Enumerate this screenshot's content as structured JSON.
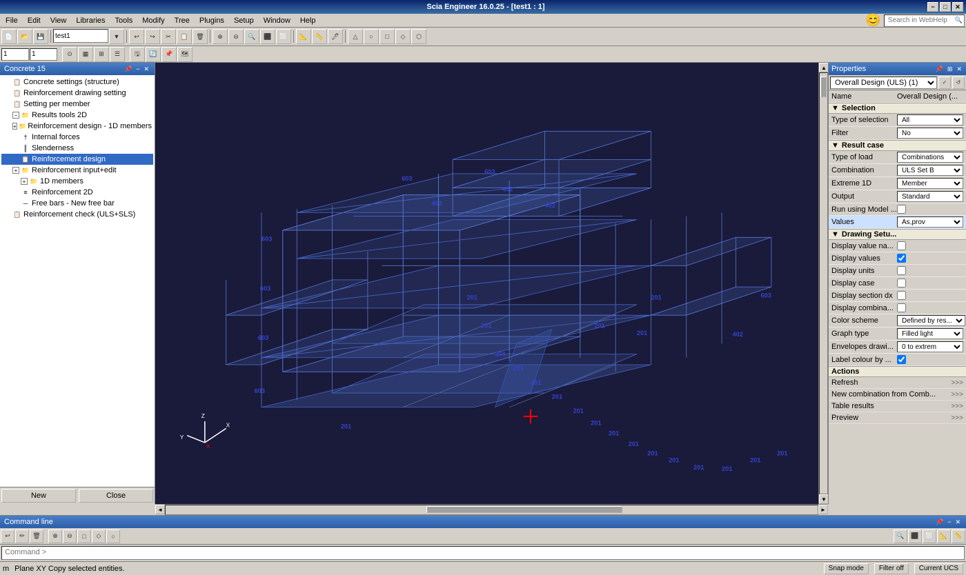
{
  "titlebar": {
    "title": "Scia Engineer 16.0.25 - [test1 : 1]",
    "minimize": "−",
    "maximize": "□",
    "close": "✕"
  },
  "menubar": {
    "items": [
      "File",
      "Edit",
      "View",
      "Libraries",
      "Tools",
      "Modify",
      "Tree",
      "Plugins",
      "Setup",
      "Window",
      "Help"
    ]
  },
  "webhelp": {
    "placeholder": "Search in WebHelp"
  },
  "leftpanel": {
    "title": "Concrete 15",
    "items": [
      {
        "label": "Concrete settings (structure)",
        "indent": 1,
        "icon": "📋",
        "expand": null
      },
      {
        "label": "Reinforcement drawing setting",
        "indent": 1,
        "icon": "📋",
        "expand": null
      },
      {
        "label": "Setting per member",
        "indent": 1,
        "icon": "📋",
        "expand": null
      },
      {
        "label": "Results tools 2D",
        "indent": 1,
        "icon": "📁",
        "expand": "-"
      },
      {
        "label": "Reinforcement design - 1D members",
        "indent": 1,
        "icon": "📁",
        "expand": "+"
      },
      {
        "label": "Internal forces",
        "indent": 2,
        "icon": "📋",
        "expand": null
      },
      {
        "label": "Slenderness",
        "indent": 2,
        "icon": "📋",
        "expand": null
      },
      {
        "label": "Reinforcement design",
        "indent": 2,
        "icon": "📋",
        "expand": null,
        "selected": true
      },
      {
        "label": "Reinforcement input+edit",
        "indent": 1,
        "icon": "📁",
        "expand": "+"
      },
      {
        "label": "1D members",
        "indent": 2,
        "icon": "📁",
        "expand": "+"
      },
      {
        "label": "Reinforcement 2D",
        "indent": 2,
        "icon": "📋",
        "expand": null
      },
      {
        "label": "Free bars - New free bar",
        "indent": 2,
        "icon": "📋",
        "expand": null
      },
      {
        "label": "Reinforcement check (ULS+SLS)",
        "indent": 1,
        "icon": "📋",
        "expand": null
      }
    ],
    "bottom_buttons": [
      "New",
      "Close"
    ]
  },
  "rightpanel": {
    "title": "Properties",
    "dropdown_label": "Overall Design (ULS) (1)",
    "name_label": "Name",
    "name_value": "Overall Design (...",
    "sections": {
      "selection": {
        "header": "Selection",
        "rows": [
          {
            "label": "Type of selection",
            "value": "All",
            "type": "dropdown"
          },
          {
            "label": "Filter",
            "value": "No",
            "type": "dropdown"
          }
        ]
      },
      "result_case": {
        "header": "Result case",
        "rows": [
          {
            "label": "Type of load",
            "value": "Combinations",
            "type": "dropdown"
          },
          {
            "label": "Combination",
            "value": "ULS Set B",
            "type": "dropdown"
          },
          {
            "label": "Extreme 1D",
            "value": "Member",
            "type": "dropdown"
          },
          {
            "label": "Output",
            "value": "Standard",
            "type": "dropdown"
          },
          {
            "label": "Run using Model ...",
            "value": "",
            "type": "checkbox",
            "checked": false
          },
          {
            "label": "Values",
            "value": "As,prov",
            "type": "dropdown_highlight"
          }
        ]
      },
      "drawing_setup": {
        "header": "Drawing Setu...",
        "rows": [
          {
            "label": "Display value na...",
            "value": "",
            "type": "checkbox",
            "checked": false
          },
          {
            "label": "Display values",
            "value": "",
            "type": "checkbox",
            "checked": true
          },
          {
            "label": "Display units",
            "value": "",
            "type": "checkbox",
            "checked": false
          },
          {
            "label": "Display case",
            "value": "",
            "type": "checkbox",
            "checked": false
          },
          {
            "label": "Display section dx",
            "value": "",
            "type": "checkbox",
            "checked": false
          },
          {
            "label": "Display combina...",
            "value": "",
            "type": "checkbox",
            "checked": false
          },
          {
            "label": "Color scheme",
            "value": "Defined by res...",
            "type": "dropdown"
          },
          {
            "label": "Graph type",
            "value": "Filled light",
            "type": "dropdown"
          },
          {
            "label": "Envelopes drawi...",
            "value": "0 to extrem",
            "type": "dropdown"
          },
          {
            "label": "Label colour by ...",
            "value": "",
            "type": "checkbox",
            "checked": true
          }
        ]
      },
      "actions": {
        "header": "Actions",
        "buttons": [
          {
            "label": "Refresh",
            "arrow": ">>>"
          },
          {
            "label": "New combination from Comb...",
            "arrow": ">>>"
          },
          {
            "label": "Table results",
            "arrow": ">>>"
          },
          {
            "label": "Preview",
            "arrow": ">>>"
          }
        ]
      }
    }
  },
  "commandline": {
    "title": "Command line",
    "prompt": "Command >"
  },
  "statusbar": {
    "left": "m",
    "center": "Plane XY  Copy selected entities.",
    "snap": "Snap mode",
    "filter": "Filter off",
    "ucs": "Current UCS"
  },
  "viewport": {
    "numbers": [
      "603",
      "603",
      "603",
      "603",
      "603",
      "603",
      "402",
      "402",
      "402",
      "402",
      "201",
      "201",
      "201",
      "201",
      "201",
      "201",
      "201",
      "201",
      "201",
      "201",
      "201",
      "201",
      "201",
      "201",
      "201",
      "201",
      "201",
      "201",
      "201",
      "201",
      "603",
      "402",
      "603"
    ]
  }
}
